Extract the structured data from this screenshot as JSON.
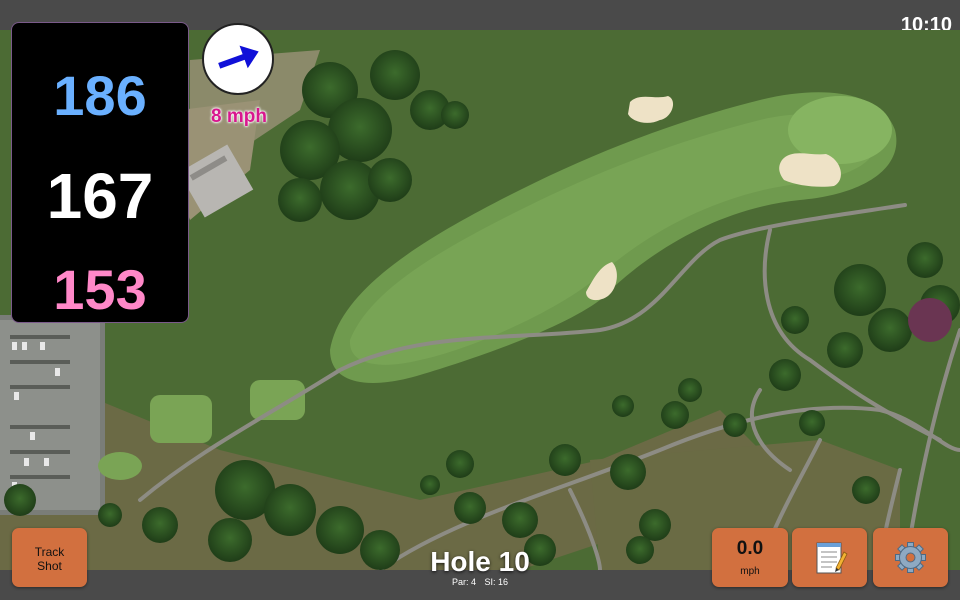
{
  "status": {
    "time": "10:10"
  },
  "distances": {
    "back": "186",
    "middle": "167",
    "front": "153"
  },
  "wind": {
    "speed_label": "8 mph",
    "arrow_icon": "arrow-right-icon"
  },
  "hole": {
    "title": "Hole 10",
    "par": "Par: 4",
    "si": "SI: 16"
  },
  "buttons": {
    "track_shot": [
      "Track",
      "Shot"
    ],
    "speed": {
      "value": "0.0",
      "unit": "mph"
    },
    "notes_icon": "notepad-icon",
    "settings_icon": "gear-icon"
  },
  "colors": {
    "back_distance": "#6ab0ff",
    "middle_distance": "#ffffff",
    "front_distance": "#ff88c8",
    "wind_label": "#d8168e",
    "button_bg": "#d2703f",
    "bar_bg": "#4a4a4a"
  }
}
